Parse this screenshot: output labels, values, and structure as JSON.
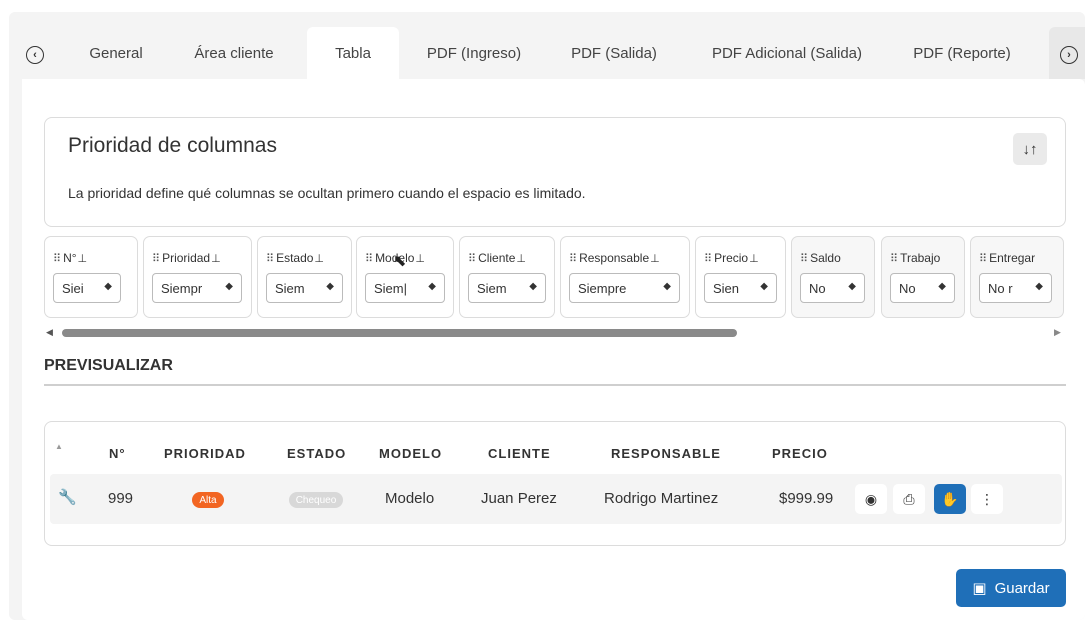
{
  "tabs": [
    {
      "label": "General"
    },
    {
      "label": "Área cliente"
    },
    {
      "label": "Tabla",
      "active": true
    },
    {
      "label": "PDF (Ingreso)"
    },
    {
      "label": "PDF (Salida)"
    },
    {
      "label": "PDF Adicional (Salida)"
    },
    {
      "label": "PDF (Reporte)"
    }
  ],
  "priority": {
    "title": "Prioridad de columnas",
    "description": "La prioridad define qué columnas se ocultan primero cuando el espacio es limitado.",
    "sort_icon": "sort-arrows-icon"
  },
  "columns": [
    {
      "label": "N°",
      "pinned": true,
      "value": "Siei"
    },
    {
      "label": "Prioridad",
      "pinned": true,
      "value": "Siempr"
    },
    {
      "label": "Estado",
      "pinned": true,
      "value": "Siem"
    },
    {
      "label": "Modelo",
      "pinned": true,
      "value": "Siem|"
    },
    {
      "label": "Cliente",
      "pinned": true,
      "value": "Siem"
    },
    {
      "label": "Responsable",
      "pinned": true,
      "value": "Siempre"
    },
    {
      "label": "Precio",
      "pinned": true,
      "value": "Sien"
    },
    {
      "label": "Saldo",
      "pinned": false,
      "value": "No"
    },
    {
      "label": "Trabajo",
      "pinned": false,
      "value": "No"
    },
    {
      "label": "Entregar",
      "pinned": false,
      "value": "No r"
    }
  ],
  "preview": {
    "label": "PREVISUALIZAR",
    "headers": {
      "num": "N°",
      "prioridad": "PRIORIDAD",
      "estado": "ESTADO",
      "modelo": "MODELO",
      "cliente": "CLIENTE",
      "responsable": "RESPONSABLE",
      "precio": "PRECIO"
    },
    "row": {
      "num": "999",
      "prioridad": "Alta",
      "estado": "Chequeo",
      "modelo": "Modelo",
      "cliente": "Juan Perez",
      "responsable": "Rodrigo Martinez",
      "precio": "$999.99"
    },
    "actions": [
      "eye-icon",
      "print-icon",
      "handshake-icon",
      "more-icon"
    ]
  },
  "save_label": "Guardar",
  "colors": {
    "primary": "#1f6fb8",
    "alta": "#f26522",
    "chequeo": "#d8d8d8"
  }
}
